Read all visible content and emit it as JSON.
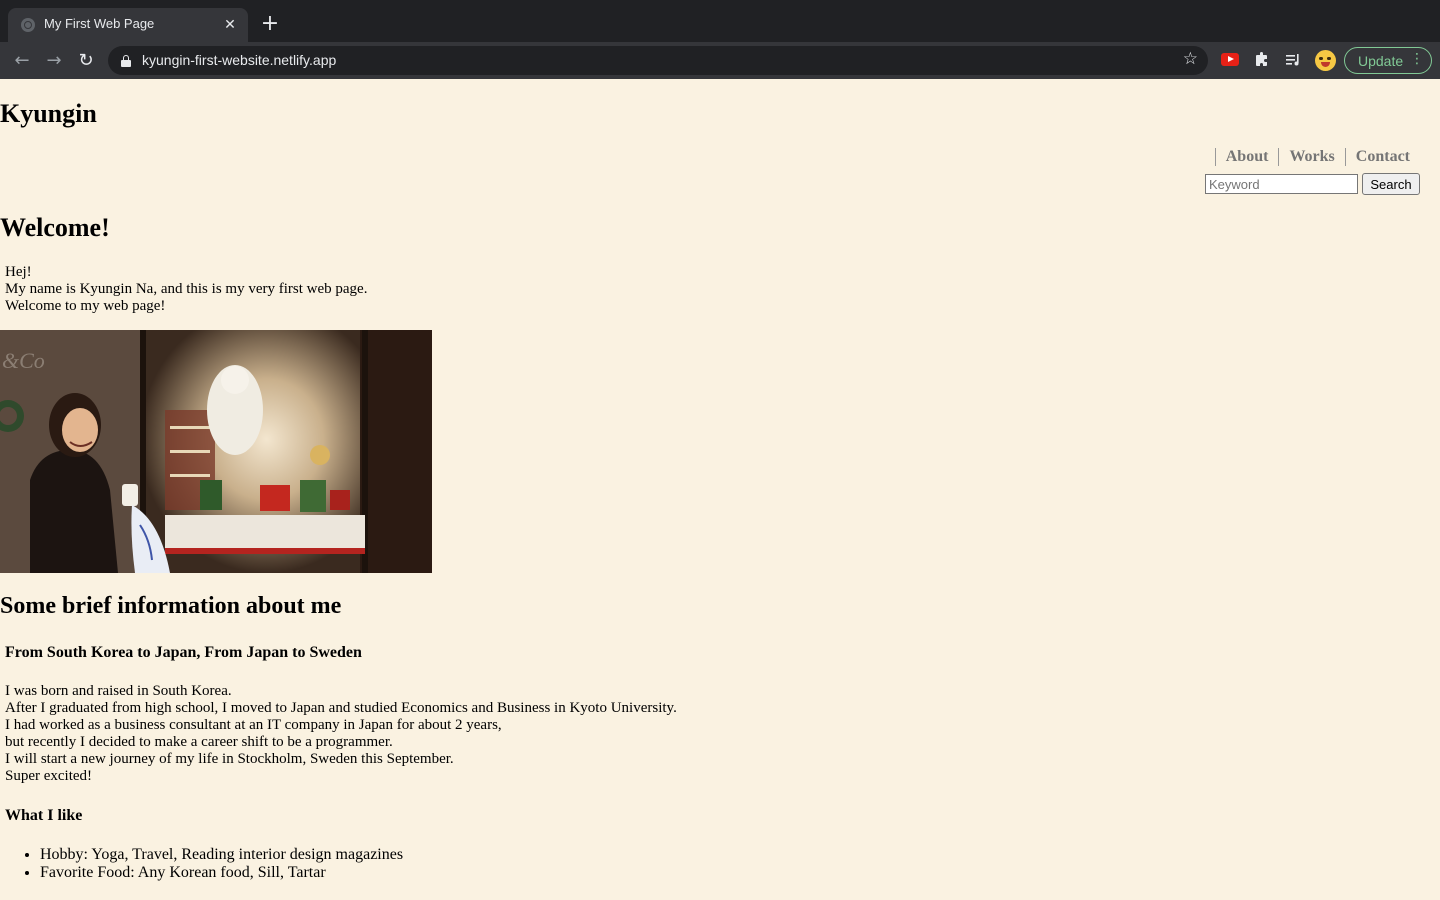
{
  "browser": {
    "tab_title": "My First Web Page",
    "tab_close": "✕",
    "new_tab": "+",
    "back_icon": "←",
    "forward_icon": "→",
    "reload_icon": "↻",
    "url": "kyungin-first-website.netlify.app",
    "star_icon": "☆",
    "update_label": "Update",
    "menu_icon": "⋮"
  },
  "site": {
    "title": "Kyungin",
    "nav": [
      "About",
      "Works",
      "Contact"
    ],
    "search_placeholder": "Keyword",
    "search_button": "Search"
  },
  "welcome": {
    "heading": "Welcome!",
    "lines": [
      "Hej!",
      "My name is Kyungin Na, and this is my very first web page.",
      "Welcome to my web page!"
    ]
  },
  "about": {
    "heading": "Some brief information about me",
    "journey_heading": "From South Korea to Japan, From Japan to Sweden",
    "bio_lines": [
      "I was born and raised in South Korea.",
      "After I graduated from high school, I moved to Japan and studied Economics and Business in Kyoto University.",
      "I had worked as a business consultant at an IT company in Japan for about 2 years,",
      "but recently I decided to make a career shift to be a programmer.",
      "I will start a new journey of my life in Stockholm, Sweden this September.",
      "Super excited!"
    ],
    "likes_heading": "What I like",
    "likes": [
      "Hobby: Yoga, Travel, Reading interior design magazines",
      "Favorite Food: Any Korean food, Sill, Tartar"
    ]
  }
}
